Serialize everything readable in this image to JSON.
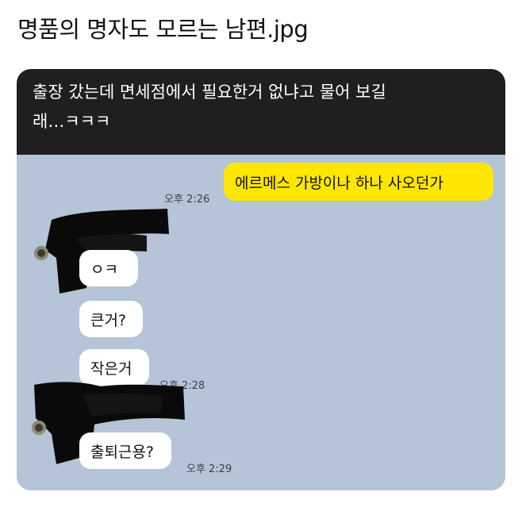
{
  "post": {
    "title": "명품의 명자도 모르는 남편.jpg"
  },
  "caption": {
    "line1": "출장 갔는데 면세점에서 필요한거 없냐고 물어 보길",
    "line2": "래…ㅋㅋㅋ"
  },
  "chat": {
    "messages": [
      {
        "sender": "me",
        "text": "에르메스 가방이나 하나 사오던가",
        "time": "오후 2:26"
      },
      {
        "sender": "husband",
        "text": "ㅇㅋ"
      },
      {
        "sender": "husband",
        "text": "큰거?"
      },
      {
        "sender": "husband",
        "text": "작은거",
        "time": "오후 2:28"
      },
      {
        "sender": "husband",
        "text": "출퇴근용?",
        "time": "오후 2:29"
      }
    ]
  },
  "colors": {
    "chat_background": "#b5c4d6",
    "caption_background": "#1f1f1f",
    "outgoing_bubble": "#ffe600",
    "incoming_bubble": "#ffffff",
    "redaction": "#0a0a0a"
  }
}
